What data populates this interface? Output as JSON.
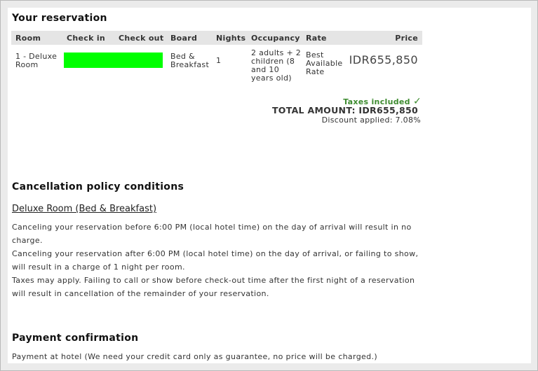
{
  "reservation": {
    "heading": "Your reservation",
    "columns": [
      "Room",
      "Check in",
      "Check out",
      "Board",
      "Nights",
      "Occupancy",
      "Rate",
      "Price"
    ],
    "row": {
      "room": "1 - Deluxe Room",
      "board": "Bed & Breakfast",
      "nights": "1",
      "occupancy": "2 adults + 2 children (8 and 10 years old)",
      "rate": "Best Available Rate",
      "price": "IDR655,850"
    },
    "taxes_label": "Taxes included",
    "total": "TOTAL AMOUNT: IDR655,850",
    "discount": "Discount applied: 7.08%",
    "highlight_color": "#00ff00"
  },
  "cancellation": {
    "heading": "Cancellation policy conditions",
    "room_title": "Deluxe Room (Bed & Breakfast)",
    "lines": [
      "Canceling your reservation before 6:00 PM (local hotel time) on the day of arrival will result in no charge.",
      "Canceling your reservation after 6:00 PM (local hotel time) on the day of arrival, or failing to show, will result in a charge of 1 night per room.",
      "Taxes may apply. Failing to call or show before check-out time after the first night of a reservation will result in cancellation of the remainder of your reservation."
    ]
  },
  "payment": {
    "heading": "Payment confirmation",
    "text": "Payment at hotel (We need your credit card only as guarantee, no price will be charged.)"
  }
}
